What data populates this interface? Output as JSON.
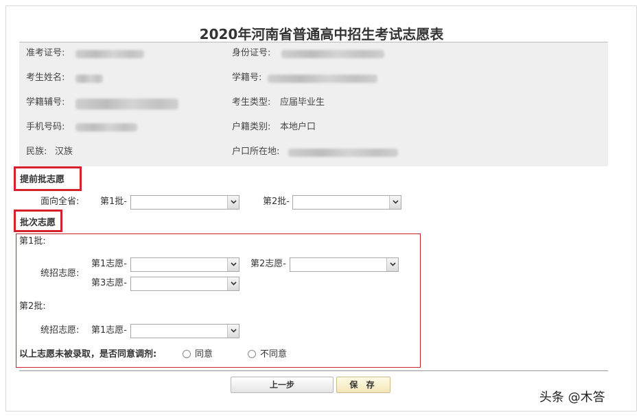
{
  "title": "2020年河南省普通高中招生考试志愿表",
  "info": {
    "exam_id_label": "准考证号:",
    "id_card_label": "身份证号:",
    "name_label": "考生姓名:",
    "student_no_label": "学籍号:",
    "aux_no_label": "学籍辅号:",
    "type_label": "考生类型:",
    "type_value": "应届毕业生",
    "phone_label": "手机号码:",
    "hukou_type_label": "户籍类别:",
    "hukou_type_value": "本地户口",
    "ethnicity_label": "民族:",
    "ethnicity_value": "汉族",
    "hukou_location_label": "户口所在地:"
  },
  "early_batch": {
    "heading": "提前批志愿",
    "scope_label": "面向全省:",
    "batch1_label": "第1批-",
    "batch2_label": "第2批-"
  },
  "batch": {
    "heading": "批次志愿",
    "batch1": {
      "label": "第1批:",
      "unified_label": "统招志愿:",
      "choice1_label": "第1志愿-",
      "choice2_label": "第2志愿-",
      "choice3_label": "第3志愿-"
    },
    "batch2": {
      "label": "第2批:",
      "unified_label": "统招志愿:",
      "choice1_label": "第1志愿-"
    },
    "adjust_question": "以上志愿未被录取，是否同意调剂:",
    "agree_label": "同意",
    "disagree_label": "不同意"
  },
  "buttons": {
    "prev": "上一步",
    "save": "保 存"
  },
  "watermark": "头条 @木答",
  "colors": {
    "highlight_red": "#d6202a",
    "info_bg": "#efefef"
  }
}
